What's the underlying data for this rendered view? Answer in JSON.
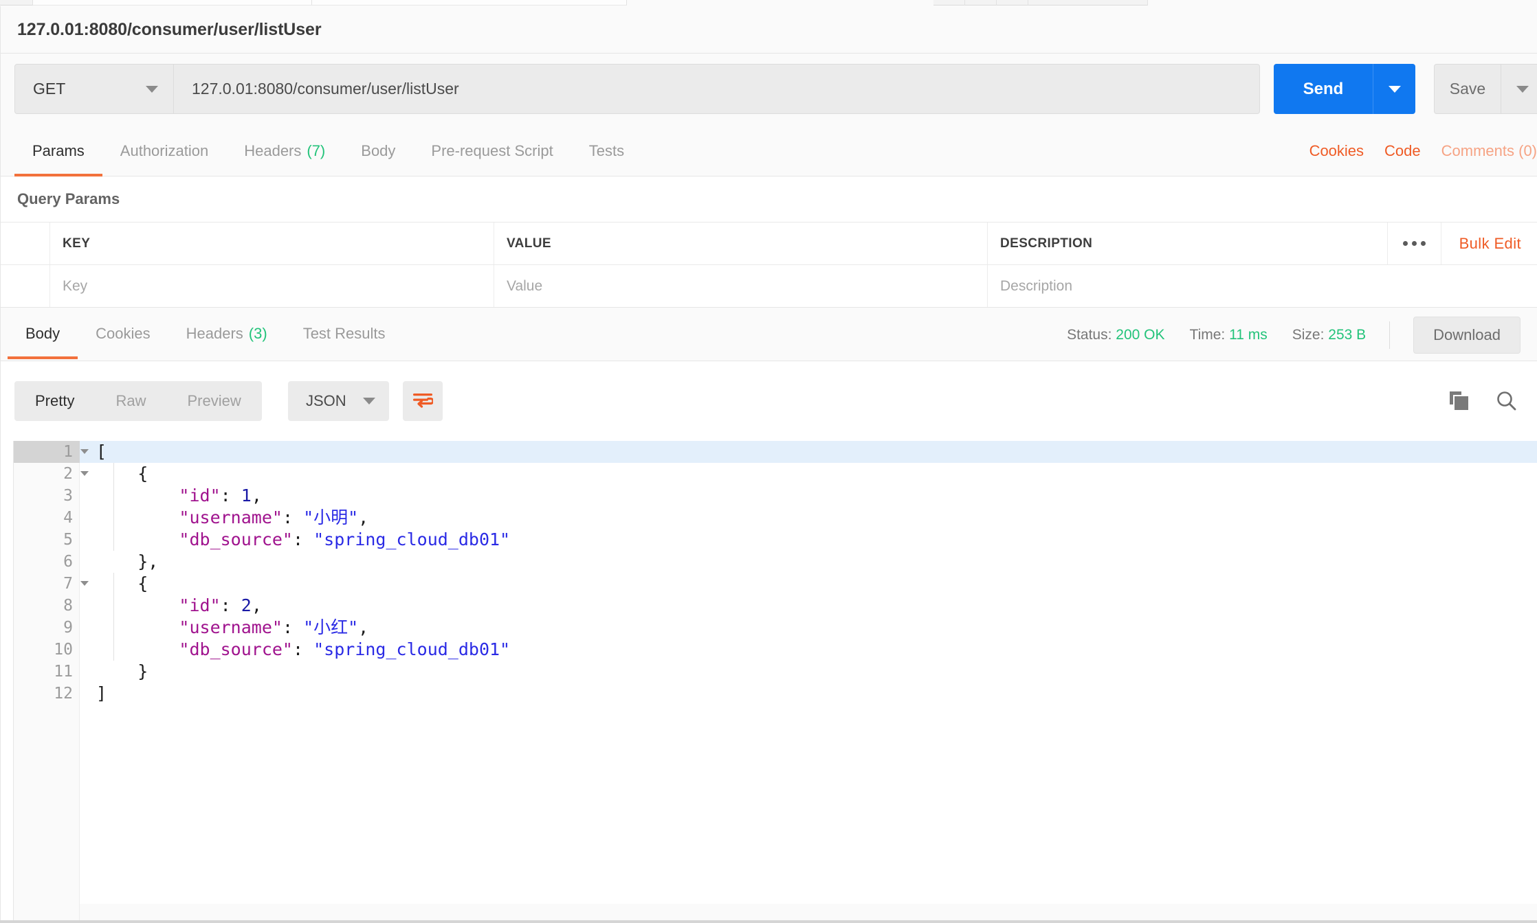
{
  "request": {
    "title": "127.0.01:8080/consumer/user/listUser",
    "method": "GET",
    "url": "127.0.01:8080/consumer/user/listUser",
    "send_label": "Send",
    "save_label": "Save",
    "tabs": [
      {
        "label": "Params",
        "count": ""
      },
      {
        "label": "Authorization",
        "count": ""
      },
      {
        "label": "Headers",
        "count": "(7)"
      },
      {
        "label": "Body",
        "count": ""
      },
      {
        "label": "Pre-request Script",
        "count": ""
      },
      {
        "label": "Tests",
        "count": ""
      }
    ],
    "links": [
      {
        "label": "Cookies"
      },
      {
        "label": "Code"
      },
      {
        "label": "Comments (0)"
      }
    ]
  },
  "query_params": {
    "section_title": "Query Params",
    "headers": {
      "key": "KEY",
      "value": "VALUE",
      "description": "DESCRIPTION"
    },
    "placeholders": {
      "key": "Key",
      "value": "Value",
      "description": "Description"
    },
    "bulk_edit_label": "Bulk Edit"
  },
  "response": {
    "tabs": [
      {
        "label": "Body",
        "count": ""
      },
      {
        "label": "Cookies",
        "count": ""
      },
      {
        "label": "Headers",
        "count": "(3)"
      },
      {
        "label": "Test Results",
        "count": ""
      }
    ],
    "status_label": "Status:",
    "status_value": "200 OK",
    "time_label": "Time:",
    "time_value": "11 ms",
    "size_label": "Size:",
    "size_value": "253 B",
    "download_label": "Download",
    "view_modes": [
      {
        "label": "Pretty"
      },
      {
        "label": "Raw"
      },
      {
        "label": "Preview"
      }
    ],
    "format": "JSON",
    "body_lines": [
      {
        "n": "1",
        "fold": true,
        "html": "["
      },
      {
        "n": "2",
        "fold": true,
        "html": "    {"
      },
      {
        "n": "3",
        "fold": false,
        "html": "        \"id\": 1,"
      },
      {
        "n": "4",
        "fold": false,
        "html": "        \"username\": \"小明\","
      },
      {
        "n": "5",
        "fold": false,
        "html": "        \"db_source\": \"spring_cloud_db01\""
      },
      {
        "n": "6",
        "fold": false,
        "html": "    },"
      },
      {
        "n": "7",
        "fold": true,
        "html": "    {"
      },
      {
        "n": "8",
        "fold": false,
        "html": "        \"id\": 2,"
      },
      {
        "n": "9",
        "fold": false,
        "html": "        \"username\": \"小红\","
      },
      {
        "n": "10",
        "fold": false,
        "html": "        \"db_source\": \"spring_cloud_db01\""
      },
      {
        "n": "11",
        "fold": false,
        "html": "    }"
      },
      {
        "n": "12",
        "fold": false,
        "html": "]"
      }
    ],
    "body_json": [
      {
        "id": 1,
        "username": "小明",
        "db_source": "spring_cloud_db01"
      },
      {
        "id": 2,
        "username": "小红",
        "db_source": "spring_cloud_db01"
      }
    ]
  },
  "colors": {
    "accent_orange": "#ef5b25",
    "send_blue": "#1078f0",
    "status_green": "#23c37a",
    "json_key": "#a0138e",
    "json_string": "#2a2ae5",
    "json_number": "#1a1aa6"
  }
}
